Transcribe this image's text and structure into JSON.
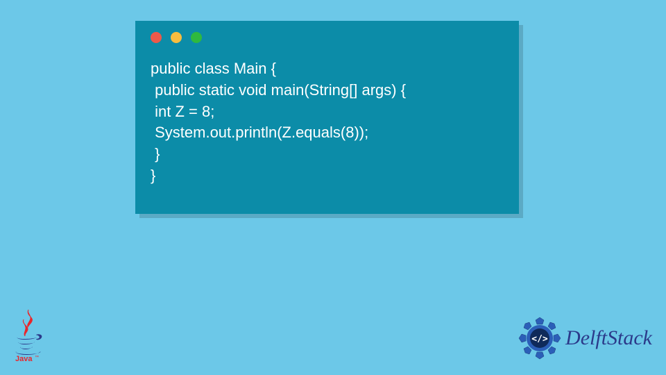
{
  "code": {
    "lines": [
      "public class Main {",
      " public static void main(String[] args) {",
      " int Z = 8;",
      " System.out.println(Z.equals(8));",
      " }",
      "}"
    ]
  },
  "branding": {
    "delftstack_label": "DelftStack"
  },
  "colors": {
    "background": "#6cc8e8",
    "window": "#0c8ca8",
    "dot_red": "#ed594a",
    "dot_yellow": "#f8bd3f",
    "dot_green": "#2fb93f",
    "brand_blue": "#2b3a8a"
  }
}
